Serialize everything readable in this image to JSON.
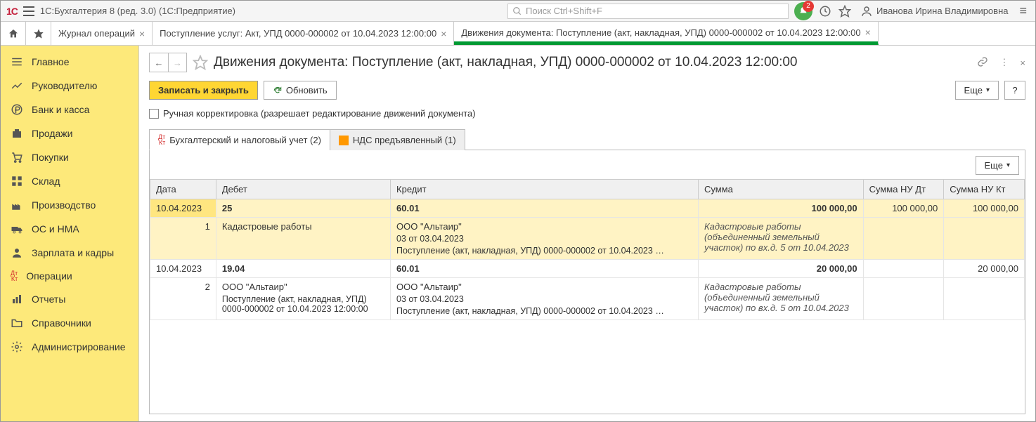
{
  "header": {
    "app_title": "1С:Бухгалтерия 8 (ред. 3.0)  (1С:Предприятие)",
    "search_placeholder": "Поиск Ctrl+Shift+F",
    "bell_count": "2",
    "user_name": "Иванова Ирина Владимировна"
  },
  "tabs": [
    {
      "label": "Журнал операций"
    },
    {
      "label": "Поступление услуг: Акт, УПД 0000-000002 от 10.04.2023 12:00:00"
    },
    {
      "label": "Движения документа: Поступление (акт, накладная, УПД) 0000-000002 от 10.04.2023 12:00:00"
    }
  ],
  "sidebar": {
    "items": [
      "Главное",
      "Руководителю",
      "Банк и касса",
      "Продажи",
      "Покупки",
      "Склад",
      "Производство",
      "ОС и НМА",
      "Зарплата и кадры",
      "Операции",
      "Отчеты",
      "Справочники",
      "Администрирование"
    ]
  },
  "page": {
    "title": "Движения документа: Поступление (акт, накладная, УПД) 0000-000002 от 10.04.2023 12:00:00",
    "btn_save_close": "Записать и закрыть",
    "btn_refresh": "Обновить",
    "btn_more": "Еще",
    "btn_help": "?",
    "manual_label": "Ручная корректировка (разрешает редактирование движений документа)",
    "tab_accounting": "Бухгалтерский и налоговый учет (2)",
    "tab_vat": "НДС предъявленный (1)"
  },
  "table": {
    "headers": {
      "date": "Дата",
      "debit": "Дебет",
      "credit": "Кредит",
      "sum": "Сумма",
      "sum_nu_dt": "Сумма НУ Дт",
      "sum_nu_kt": "Сумма НУ Кт"
    },
    "rows": [
      {
        "date": "10.04.2023",
        "num": "1",
        "debit_acc": "25",
        "debit_sub1": "Кадастровые работы",
        "credit_acc": "60.01",
        "credit_sub1": "ООО \"Альтаир\"",
        "credit_sub2": "03 от 03.04.2023",
        "credit_sub3": "Поступление (акт, накладная, УПД) 0000-000002 от 10.04.2023 …",
        "sum": "100 000,00",
        "sum_nu_dt": "100 000,00",
        "sum_nu_kt": "100 000,00",
        "desc": "Кадастровые работы (объединенный земельный участок) по вх.д. 5 от 10.04.2023"
      },
      {
        "date": "10.04.2023",
        "num": "2",
        "debit_acc": "19.04",
        "debit_sub1": "ООО \"Альтаир\"",
        "debit_sub2": "Поступление (акт, накладная, УПД) 0000-000002 от 10.04.2023 12:00:00",
        "credit_acc": "60.01",
        "credit_sub1": "ООО \"Альтаир\"",
        "credit_sub2": "03 от 03.04.2023",
        "credit_sub3": "Поступление (акт, накладная, УПД) 0000-000002 от 10.04.2023 …",
        "sum": "20 000,00",
        "sum_nu_dt": "",
        "sum_nu_kt": "20 000,00",
        "desc": "Кадастровые работы (объединенный земельный участок) по вх.д. 5 от 10.04.2023"
      }
    ]
  }
}
